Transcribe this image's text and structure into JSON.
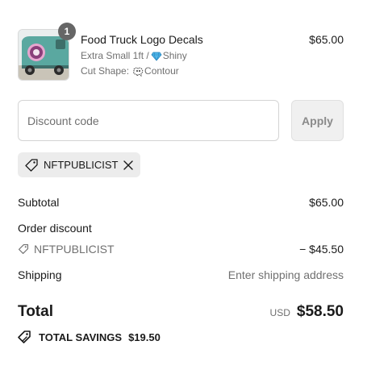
{
  "product": {
    "quantity": "1",
    "title": "Food Truck Logo Decals",
    "variant_size": "Extra Small 1ft /",
    "variant_finish": "Shiny",
    "cut_label": "Cut Shape:",
    "cut_value": "Contour",
    "price": "$65.00",
    "thumbnail_icon": "food-truck-image",
    "finish_icon": "diamond-icon",
    "cut_icon": "contour-shape-icon"
  },
  "discount": {
    "placeholder": "Discount code",
    "apply_label": "Apply",
    "applied_code": "NFTPUBLICIST"
  },
  "summary": {
    "subtotal_label": "Subtotal",
    "subtotal_value": "$65.00",
    "order_discount_label": "Order discount",
    "discount_code": "NFTPUBLICIST",
    "discount_value": "− $45.50",
    "shipping_label": "Shipping",
    "shipping_value": "Enter shipping address",
    "total_label": "Total",
    "currency": "USD",
    "total_value": "$58.50",
    "savings_label": "TOTAL SAVINGS",
    "savings_value": "$19.50"
  },
  "colors": {
    "badge": "#666666",
    "muted_text": "#707070",
    "chip_bg": "#ececec",
    "truck_body": "#5aa8a0"
  }
}
